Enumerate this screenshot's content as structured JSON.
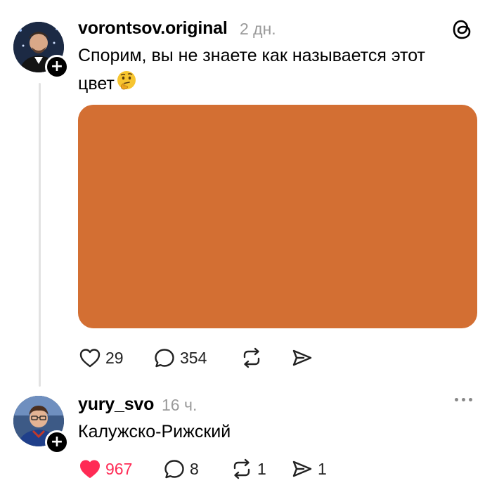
{
  "post": {
    "username": "vorontsov.original",
    "time": "2 дн.",
    "text_line1": "Спорим, вы не знаете как называется этот",
    "text_line2": "цвет",
    "emoji": "thinking-face",
    "swatch_color": "#D36F33",
    "likes": "29",
    "comments": "354"
  },
  "reply": {
    "username": "yury_svo",
    "time": "16 ч.",
    "text": "Калужско-Рижский",
    "likes": "967",
    "comments": "8",
    "reposts": "1",
    "shares": "1"
  },
  "colors": {
    "like_active": "#FF2B55",
    "muted": "#9A9A9A",
    "thread_line": "#E2E2E2"
  }
}
